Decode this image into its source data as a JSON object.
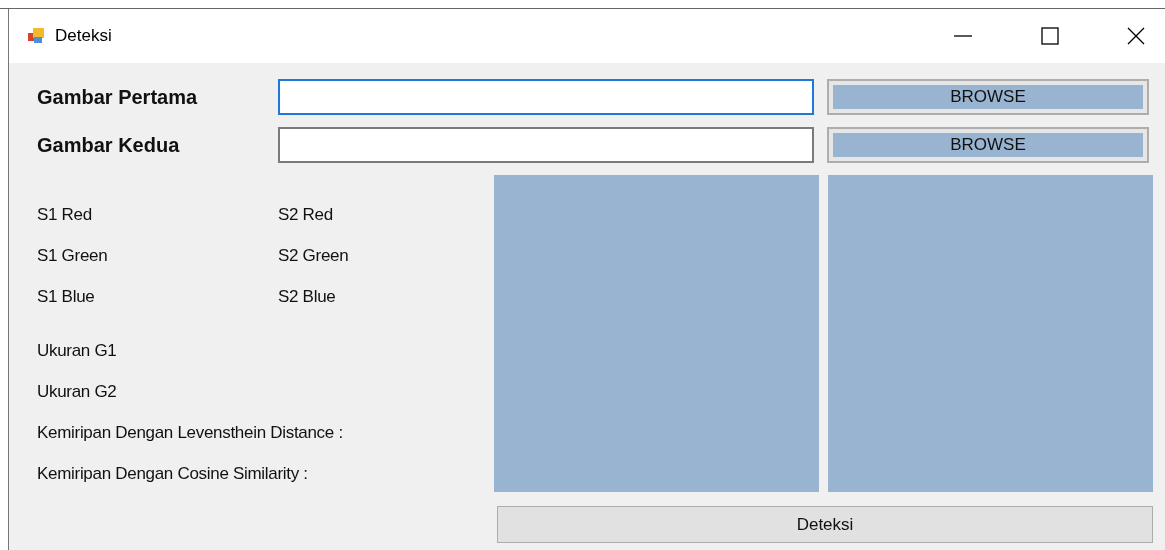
{
  "window": {
    "title": "Deteksi"
  },
  "inputs": [
    {
      "label": "Gambar Pertama",
      "focused": true,
      "button": "BROWSE"
    },
    {
      "label": "Gambar Kedua",
      "focused": false,
      "button": "BROWSE"
    }
  ],
  "stats_left": [
    "S1 Red",
    "S1 Green",
    "S1 Blue"
  ],
  "stats_right": [
    "S2 Red",
    "S2 Green",
    "S2 Blue"
  ],
  "results": [
    "Ukuran G1",
    "Ukuran G2",
    "Kemiripan Dengan Levensthein Distance :",
    "Kemiripan Dengan Cosine Similarity :"
  ],
  "detect_button": "Deteksi"
}
